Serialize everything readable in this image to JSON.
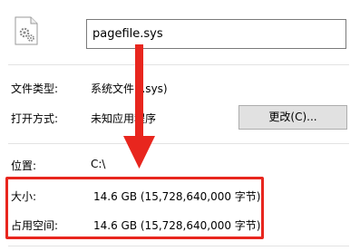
{
  "filename": "pagefile.sys",
  "fields": {
    "file_type_label": "文件类型:",
    "file_type_value": "系统文件 (.sys)",
    "open_with_label": "打开方式:",
    "open_with_value": "未知应用程序",
    "change_button": "更改(C)...",
    "location_label": "位置:",
    "location_value": "C:\\",
    "size_label": "大小:",
    "size_value": "14.6 GB (15,728,640,000 字节)",
    "size_on_disk_label": "占用空间:",
    "size_on_disk_value": "14.6 GB (15,728,640,000 字节)"
  },
  "icons": {
    "file": "system-file-gear-icon"
  },
  "colors": {
    "highlight": "#e8261e",
    "arrow": "#e8261e"
  }
}
